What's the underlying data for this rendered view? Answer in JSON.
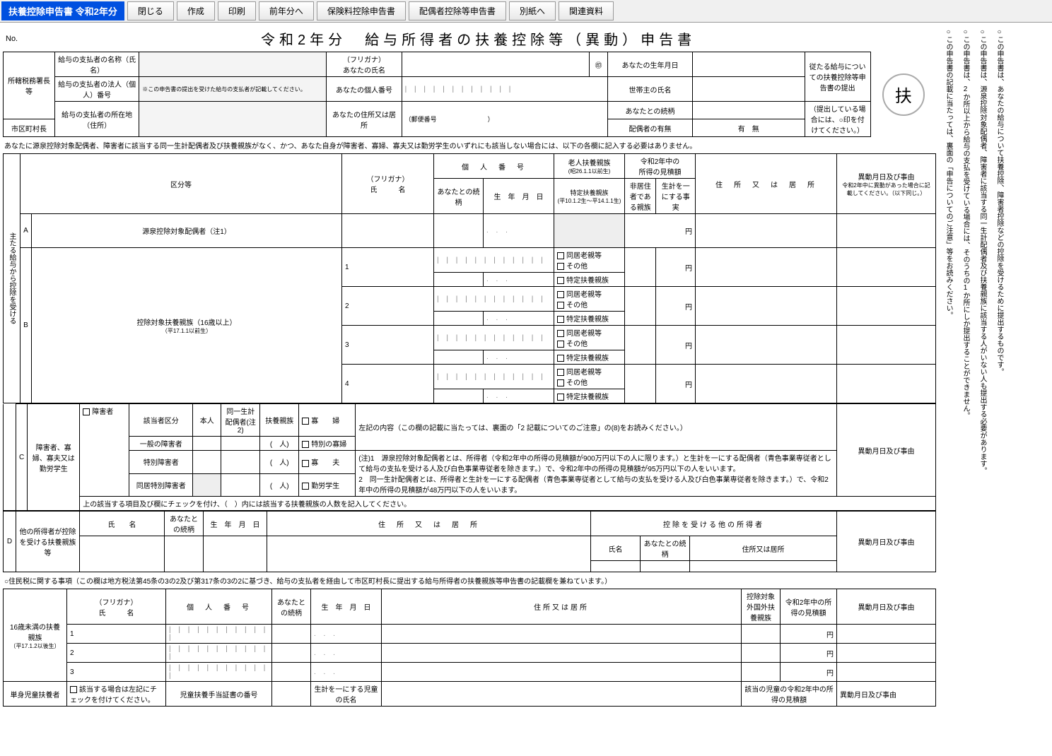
{
  "toolbar": {
    "title": "扶養控除申告書 令和2年分",
    "close": "閉じる",
    "create": "作成",
    "print": "印刷",
    "prev_year": "前年分へ",
    "insurance": "保険料控除申告書",
    "spouse": "配偶者控除等申告書",
    "attachment": "別紙へ",
    "related": "関連資料"
  },
  "header": {
    "no": "No.",
    "doc_title": "令和2年分　給与所得者の扶養控除等（異動）申告書"
  },
  "top_labels": {
    "tax_office": "所轄税務署長等",
    "payer_name": "給与の支払者の名称（氏名）",
    "payer_number": "給与の支払者の法人（個人）番号",
    "payer_number_note": "※この申告書の提出を受けた給与の支払者が記載してください。",
    "payer_address": "給与の支払者の所在地（住所）",
    "tax_office2": "税務署長",
    "city_mayor": "市区町村長",
    "furigana": "（フリガナ）",
    "your_name": "あなたの氏名",
    "your_number": "あなたの個人番号",
    "your_address": "あなたの住所又は居所",
    "postal": "（郵便番号　　　　　　　　）",
    "your_birth": "あなたの生年月日",
    "householder": "世帯主の氏名",
    "relation": "あなたとの続柄",
    "spouse_exist": "配偶者の有無",
    "yes": "有",
    "no": "無",
    "seal": "㊞",
    "submit_note": "従たる給与についての扶養控除等申告書の提出",
    "submit_note2": "（提出している場合には、○印を付けてください。）",
    "stamp_char": "扶"
  },
  "instruction": "あなたに源泉控除対象配偶者、障害者に該当する同一生計配偶者及び扶養親族がなく、かつ、あなた自身が障害者、寡婦、寡夫又は勤労学生のいずれにも該当しない場合には、以下の各欄に記入する必要はありません。",
  "main_table": {
    "col_kubun": "区分等",
    "col_furigana": "（フリガナ）",
    "col_name": "氏　　　名",
    "col_mynumber": "個　人　番　号",
    "col_relation": "あなたとの続柄",
    "col_birth": "生　年　月　日",
    "col_elderly": "老人扶養親族",
    "col_elderly_sub": "(昭26.1.1以前生)",
    "col_special": "特定扶養親族",
    "col_special_sub": "(平10.1.2生～平14.1.1生)",
    "col_income_hdr": "令和2年中の",
    "col_income": "所得の見積額",
    "col_nonres": "非居住者である親族",
    "col_livelihood": "生計を一にする事実",
    "col_address": "住　所　又　は　居　所",
    "col_change": "異動月日及び事由",
    "col_change_sub": "令和2年中に異動があった場合に記載してください。（以下同じ。）",
    "vhead_main": "主たる給与から控除を受ける",
    "row_a": "A",
    "row_a_label": "源泉控除対象配偶者（注1）",
    "row_b": "B",
    "row_b_label": "控除対象扶養親族（16歳以上）",
    "row_b_sub": "（平17.1.1以前生）",
    "checkbox_cohabit": "同居老親等",
    "checkbox_other": "その他",
    "checkbox_special": "特定扶養親族",
    "yen": "円",
    "row_c": "C",
    "row_c_label": "障害者、寡婦、寡夫又は勤労学生",
    "disabled_cb": "障害者",
    "col_gaito": "該当者区分",
    "col_honnin": "本人",
    "col_doitsu": "同一生計配偶者(注2)",
    "col_fuyou": "扶養親族",
    "disabled_general": "一般の障害者",
    "disabled_special": "特別障害者",
    "disabled_cohabit": "同居特別障害者",
    "person_unit": "人",
    "widow": "寡　　婦",
    "widow_special": "特別の寡婦",
    "widower": "寡　　夫",
    "student": "勤労学生",
    "c_note": "左記の内容（この欄の記載に当たっては、裏面の「2 記載についてのご注意」の(8)をお読みください。）",
    "c_instruction": "上の該当する項目及び欄にチェックを付け、（　）内には該当する扶養親族の人数を記入してください。",
    "note1": "(注)1　源泉控除対象配偶者とは、所得者（令和2年中の所得の見積額が900万円以下の人に限ります。）と生計を一にする配偶者（青色事業専従者として給与の支払を受ける人及び白色事業専従者を除きます。）で、令和2年中の所得の見積額が95万円以下の人をいいます。",
    "note2": "2　同一生計配偶者とは、所得者と生計を一にする配偶者（青色事業専従者として給与の支払を受ける人及び白色事業専従者を除きます。）で、令和2年中の所得の見積額が48万円以下の人をいいます。",
    "row_d": "D",
    "row_d_label": "他の所得者が控除を受ける扶養親族等",
    "d_col_name": "氏　　名",
    "d_col_rel": "あなたとの続柄",
    "d_col_birth": "生　年　月　日",
    "d_col_addr": "住　所　又　は　居　所",
    "d_col_other": "控除を受ける他の所得者",
    "d_col_other_name": "氏名",
    "d_col_other_rel": "あなたとの続柄",
    "d_col_other_addr": "住所又は居所"
  },
  "resident_tax": {
    "heading": "○住民税に関する事項（この欄は地方税法第45条の3の2及び第317条の3の2に基づき、給与の支払者を経由して市区町村長に提出する給与所得者の扶養親族等申告書の記載欄を兼ねています。）",
    "under16": "16歳未満の扶養親族",
    "under16_sub": "（平17.1.2以後生）",
    "col_furigana": "（フリガナ）",
    "col_name": "氏　　　名",
    "col_mynumber": "個　人　番　号",
    "col_rel": "あなたとの続柄",
    "col_birth": "生　年　月　日",
    "col_addr": "住所又は居所",
    "col_nonres": "控除対象外国外扶養親族",
    "col_income": "令和2年中の所得の見積額",
    "col_change": "異動月日及び事由",
    "single_parent": "単身児童扶養者",
    "single_note": "該当する場合は左記にチェックを付けてください。",
    "cert": "児童扶養手当証書の番号",
    "child_name": "生計を一にする児童の氏名",
    "child_income": "該当の児童の令和2年中の所得の見積額"
  },
  "side": {
    "n1": "○この申告書は、あなたの給与について扶養控除、障害者控除などの控除を受けるために提出するものです。",
    "n2": "○この申告書は、源泉控除対象配偶者、障害者に該当する同一生計配偶者及び扶養親族に該当する人がいない人も提出する必要があります。",
    "n3": "○この申告書は、2か所以上から給与の支払を受けている場合には、そのうちの1か所にしか提出することができません。",
    "n4": "○この申告書の記載に当たっては、裏面の「申告についてのご注意」等をお読みください。"
  }
}
